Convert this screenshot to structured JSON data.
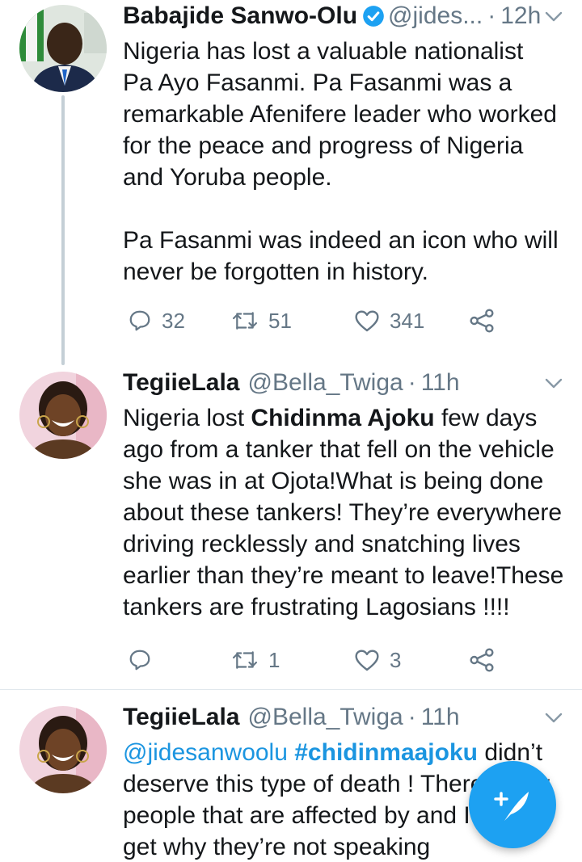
{
  "tweets": [
    {
      "name": "Babajide Sanwo-Olu",
      "verified": true,
      "handle": "@jides...",
      "dot": "·",
      "time": "12h",
      "text_1": "Nigeria has lost a valuable nationalist  Pa Ayo Fasanmi. Pa Fasanmi was a remarkable Afenifere leader who worked for the peace and progress of Nigeria and Yoruba people.",
      "text_2": "Pa Fasanmi was indeed an icon who will never be forgotten in history.",
      "replies": "32",
      "retweets": "51",
      "likes": "341"
    },
    {
      "name": "TegiieLala",
      "handle": "@Bella_Twiga",
      "dot": "·",
      "time": "11h",
      "text_pre": "Nigeria lost ",
      "text_bold": "Chidinma Ajoku",
      "text_post": " few days ago from a tanker that fell on the vehicle she was in at Ojota!What is being done about these tankers! They’re everywhere driving recklessly and snatching lives earlier than they’re meant to leave!These tankers are frustrating Lagosians !!!!",
      "replies": "",
      "retweets": "1",
      "likes": "3"
    },
    {
      "name": "TegiieLala",
      "handle": "@Bella_Twiga",
      "dot": "·",
      "time": "11h",
      "mention": "@jidesanwoolu",
      "hashtag": "#chidinmaajoku",
      "text_post": " didn’t deserve this type of death ! There many people that are affected by and I don’t get why they’re not speaking"
    }
  ],
  "colors": {
    "accent": "#1da1f2",
    "link": "#1b95e0",
    "secondary_text": "#657786"
  },
  "icons": [
    "verified-badge-icon",
    "chevron-down-icon",
    "reply-icon",
    "retweet-icon",
    "like-icon",
    "share-icon",
    "compose-tweet-icon"
  ]
}
